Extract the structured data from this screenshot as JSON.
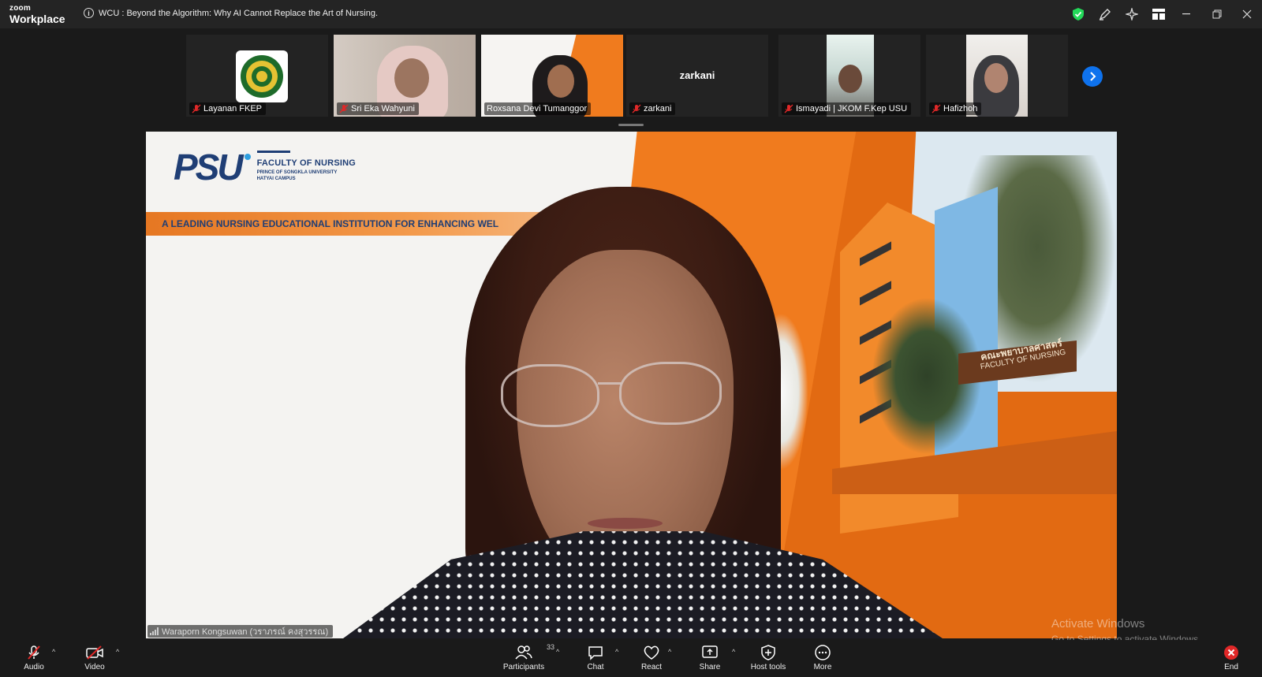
{
  "app": {
    "brand_small": "zoom",
    "brand_large": "Workplace",
    "meeting_title": "WCU : Beyond the Algorithm: Why AI Cannot Replace the Art of Nursing."
  },
  "colors": {
    "accent_blue": "#0e72ed",
    "security_green": "#23d959",
    "end_red": "#e02828",
    "mute_red": "#e02828"
  },
  "title_tools": [
    "shield-check-icon",
    "annotate-pen-icon",
    "ai-sparkle-icon",
    "view-grid-icon"
  ],
  "window_controls": [
    "minimize",
    "restore",
    "close"
  ],
  "gallery": {
    "participants": [
      {
        "name": "Layanan FKEP",
        "muted": true,
        "video": "logo"
      },
      {
        "name": "Sri Eka Wahyuni",
        "muted": true,
        "video": "on"
      },
      {
        "name": "Roxsana Devi Tumanggor",
        "muted": false,
        "video": "on"
      },
      {
        "name": "zarkani",
        "muted": true,
        "video": "off",
        "center_label": "zarkani"
      },
      {
        "name": "Ismayadi | JKOM F.Kep USU",
        "muted": true,
        "video": "on"
      },
      {
        "name": "Hafizhoh",
        "muted": true,
        "video": "on"
      }
    ]
  },
  "speaker": {
    "name": "Waraporn Kongsuwan (วราภรณ์ คงสุวรรณ)",
    "virtual_background": {
      "logo_mark": "PSU",
      "faculty": "FACULTY OF NURSING",
      "university": "PRINCE OF SONGKLA UNIVERSITY",
      "campus": "HATYAI CAMPUS",
      "tagline": "A LEADING NURSING EDUCATIONAL INSTITUTION FOR ENHANCING WEL",
      "sign_thai": "คณะพยาบาลศาสตร์",
      "sign_en": "FACULTY OF NURSING"
    }
  },
  "watermark": {
    "line1": "Activate Windows",
    "line2": "Go to Settings to activate Windows."
  },
  "toolbar": {
    "audio": "Audio",
    "video": "Video",
    "participants": "Participants",
    "participants_count": "33",
    "chat": "Chat",
    "react": "React",
    "share": "Share",
    "host_tools": "Host tools",
    "more": "More",
    "end": "End"
  }
}
